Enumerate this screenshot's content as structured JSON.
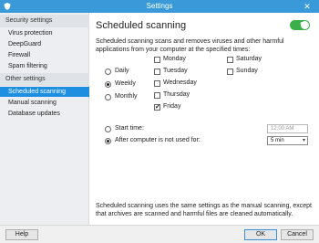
{
  "window": {
    "title": "Settings",
    "close_glyph": "✕"
  },
  "sidebar": {
    "groups": [
      {
        "header": "Security settings",
        "items": [
          "Virus protection",
          "DeepGuard",
          "Firewall",
          "Spam filtering"
        ]
      },
      {
        "header": "Other settings",
        "items": [
          "Scheduled scanning",
          "Manual scanning",
          "Database updates"
        ]
      }
    ],
    "active_item": "Scheduled scanning"
  },
  "content": {
    "heading": "Scheduled scanning",
    "toggle": {
      "label": "ON",
      "state": "on",
      "color": "#3bb04a"
    },
    "description": "Scheduled scanning scans and removes viruses and other harmful applications from your computer at the specified times:",
    "frequency": {
      "options": [
        "Daily",
        "Weekly",
        "Monthly"
      ],
      "selected": "Weekly"
    },
    "days": {
      "col1": [
        {
          "label": "Monday",
          "checked": false
        },
        {
          "label": "Tuesday",
          "checked": false
        },
        {
          "label": "Wednesday",
          "checked": false
        },
        {
          "label": "Thursday",
          "checked": false
        },
        {
          "label": "Friday",
          "checked": true
        }
      ],
      "col2": [
        {
          "label": "Saturday",
          "checked": false
        },
        {
          "label": "Sunday",
          "checked": false
        }
      ]
    },
    "start": {
      "start_time_label": "Start time:",
      "start_time_value": "12:00 AM",
      "idle_label": "After computer is not used for:",
      "idle_value": "5 min",
      "selected": "idle"
    },
    "note": "Scheduled scanning uses the same settings as the manual scanning, except that archives are scanned and harmful files are cleaned automatically."
  },
  "footer": {
    "help": "Help",
    "ok": "OK",
    "cancel": "Cancel"
  },
  "colors": {
    "titlebar": "#3a9ad9",
    "accent": "#1e8fe0"
  }
}
